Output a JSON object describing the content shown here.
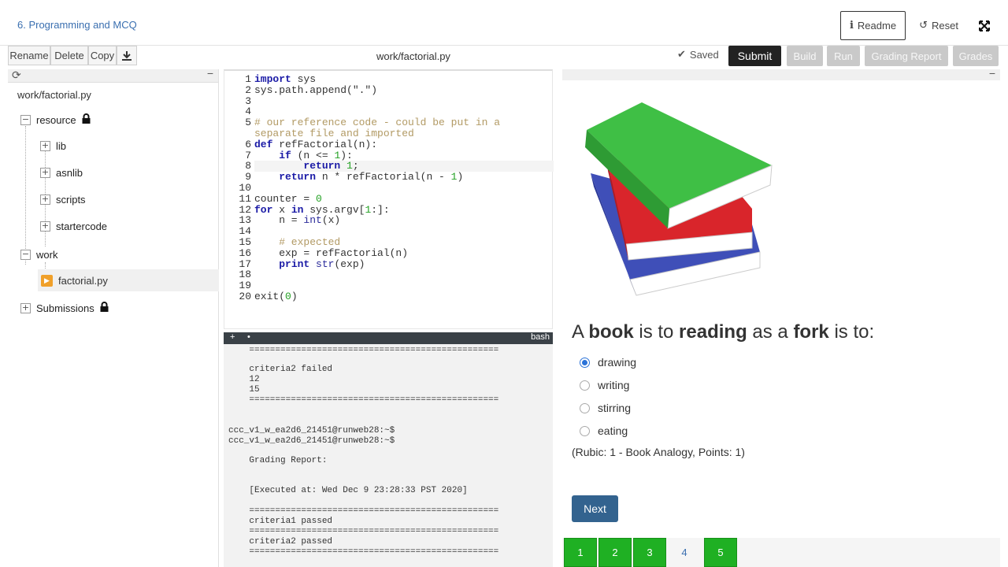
{
  "header": {
    "breadcrumb": "6. Programming and MCQ",
    "readme_label": "Readme",
    "reset_label": "Reset"
  },
  "toolbar": {
    "rename": "Rename",
    "delete": "Delete",
    "copy": "Copy",
    "filename": "work/factorial.py",
    "saved": "Saved",
    "submit": "Submit",
    "build": "Build",
    "run": "Run",
    "grading_report": "Grading Report",
    "grades": "Grades"
  },
  "sidebar": {
    "path": "work/factorial.py",
    "tree": {
      "resource": "resource",
      "lib": "lib",
      "asnlib": "asnlib",
      "scripts": "scripts",
      "startercode": "startercode",
      "work": "work",
      "file": "factorial.py",
      "submissions": "Submissions"
    }
  },
  "editor": {
    "line_numbers": [
      "1",
      "2",
      "3",
      "4",
      "5",
      "",
      "6",
      "7",
      "8",
      "9",
      "10",
      "11",
      "12",
      "13",
      "14",
      "15",
      "16",
      "17",
      "18",
      "19",
      "20"
    ],
    "lines": [
      "import sys",
      "sys.path.append(\".\")",
      "",
      "",
      "# our reference code - could be put in a",
      "separate file and imported",
      "def refFactorial(n):",
      "    if (n <= 1):",
      "        return 1;",
      "    return n * refFactorial(n - 1)",
      "",
      "counter = 0",
      "for x in sys.argv[1:]:",
      "    n = int(x)",
      "",
      "    # expected",
      "    exp = refFactorial(n)",
      "    print str(exp)",
      "",
      "",
      "exit(0)"
    ]
  },
  "terminal": {
    "tab_plus": "+",
    "tab_dot": "•",
    "shell": "bash",
    "lines": [
      "    ================================================",
      "    criteria2 failed",
      "    12",
      "    15",
      "    ================================================",
      "",
      "",
      "ccc_v1_w_ea2d6_21451@runweb28:~$",
      "ccc_v1_w_ea2d6_21451@runweb28:~$",
      "    Grading Report:",
      "",
      "",
      "    [Executed at: Wed Dec 9 23:28:33 PST 2020]",
      "",
      "    ================================================",
      "    criteria1 passed",
      "    ================================================",
      "    criteria2 passed",
      "    ================================================"
    ]
  },
  "quiz": {
    "question_parts": [
      "A ",
      "book",
      " is to ",
      "reading",
      " as a ",
      "fork",
      " is to:"
    ],
    "options": [
      "drawing",
      "writing",
      "stirring",
      "eating"
    ],
    "selected_index": 0,
    "rubric": "(Rubic: 1 - Book Analogy, Points: 1)",
    "next_label": "Next",
    "pages": [
      "1",
      "2",
      "3",
      "4",
      "5"
    ],
    "current_page": "4"
  },
  "colors": {
    "accent_blue": "#3a6fb0",
    "submit_bg": "#222222",
    "next_bg": "#33638f",
    "page_green": "#1fb023",
    "terminal_bar": "#3a4147"
  }
}
